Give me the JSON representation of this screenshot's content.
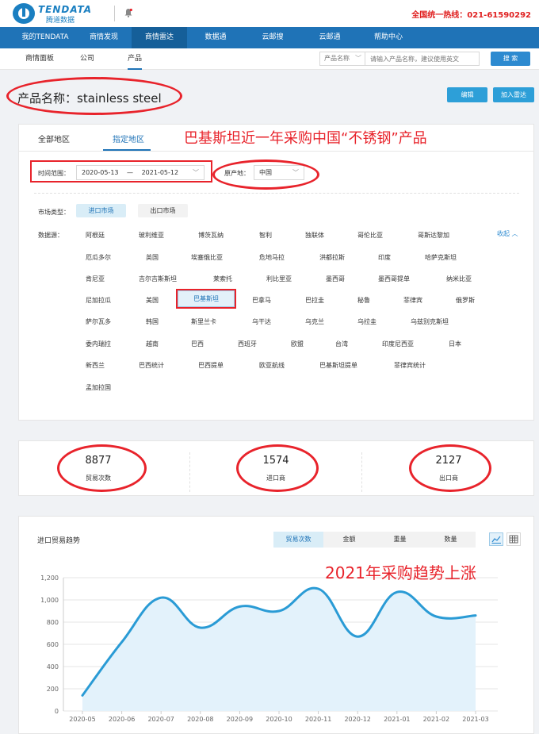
{
  "header": {
    "logo_en": "TENDATA",
    "logo_cn": "腾道数据",
    "hotline": "全国统一热线：021-61590292"
  },
  "nav": {
    "items": [
      "我的TENDATA",
      "商情发现",
      "商情雷达",
      "数据通",
      "云邮搜",
      "云邮通",
      "帮助中心"
    ],
    "active": "商情雷达"
  },
  "subnav": {
    "items": [
      "商情面板",
      "公司",
      "产品"
    ],
    "active": "产品",
    "search_type": "产品名称",
    "search_placeholder": "请输入产品名称，建议使用英文",
    "search_button": "搜 索"
  },
  "product": {
    "title": "产品名称：stainless steel",
    "edit_button": "编辑",
    "add_radar_button": "加入雷达"
  },
  "filters": {
    "tabs": [
      "全部地区",
      "指定地区"
    ],
    "active_tab": "指定地区",
    "time_label": "时间范围：",
    "date_start": "2020-05-13",
    "date_sep": "—",
    "date_end": "2021-05-12",
    "origin_label": "原产地：",
    "origin_value": "中国",
    "market_label": "市场类型：",
    "market_import": "进口市场",
    "market_export": "出口市场",
    "source_label": "数据源：",
    "collapse": "收起",
    "countries": [
      [
        "阿根廷",
        "玻利维亚",
        "博茨瓦纳",
        "智利",
        "独联体",
        "哥伦比亚",
        "哥斯达黎加"
      ],
      [
        "厄瓜多尔",
        "英国",
        "埃塞俄比亚",
        "危地马拉",
        "洪都拉斯",
        "印度",
        "哈萨克斯坦"
      ],
      [
        "肯尼亚",
        "吉尔吉斯斯坦",
        "莱索托",
        "利比里亚",
        "墨西哥",
        "墨西哥提单",
        "纳米比亚"
      ],
      [
        "尼加拉瓜",
        "美国",
        "巴基斯坦",
        "巴拿马",
        "巴拉圭",
        "秘鲁",
        "菲律宾",
        "俄罗斯"
      ],
      [
        "萨尔瓦多",
        "韩国",
        "斯里兰卡",
        "乌干达",
        "乌克兰",
        "乌拉圭",
        "乌兹别克斯坦"
      ],
      [
        "委内瑞拉",
        "越南",
        "巴西",
        "西班牙",
        "欧盟",
        "台湾",
        "印度尼西亚",
        "日本"
      ],
      [
        "新西兰",
        "巴西统计",
        "巴西提单",
        "欧亚航线",
        "巴基斯坦提单",
        "菲律宾统计"
      ],
      [
        "孟加拉国"
      ]
    ],
    "selected_country": "巴基斯坦"
  },
  "stats": [
    {
      "value": "8877",
      "label": "贸易次数"
    },
    {
      "value": "1574",
      "label": "进口商"
    },
    {
      "value": "2127",
      "label": "出口商"
    }
  ],
  "trend": {
    "title": "进口贸易趋势",
    "metrics": [
      "贸易次数",
      "金额",
      "重量",
      "数量"
    ],
    "active_metric": "贸易次数"
  },
  "annotations": {
    "note_top": "巴基斯坦近一年采购中国“不锈钢”产品",
    "note_chart": "2021年采购趋势上涨"
  },
  "colors": {
    "nav_bg": "#1f73b7",
    "accent": "#2d9fd8",
    "line": "#2a9bd5",
    "area": "#e3f2fb",
    "annotation": "#e8232b"
  },
  "chart_data": {
    "type": "area",
    "categories": [
      "2020-05",
      "2020-06",
      "2020-07",
      "2020-08",
      "2020-09",
      "2020-10",
      "2020-11",
      "2020-12",
      "2021-01",
      "2021-02",
      "2021-03"
    ],
    "values": [
      140,
      620,
      1020,
      750,
      940,
      900,
      1100,
      670,
      1070,
      850,
      860
    ],
    "y_ticks": [
      "0",
      "200",
      "400",
      "600",
      "800",
      "1,000",
      "1,200"
    ],
    "ylim": [
      0,
      1200
    ],
    "grid": true
  }
}
